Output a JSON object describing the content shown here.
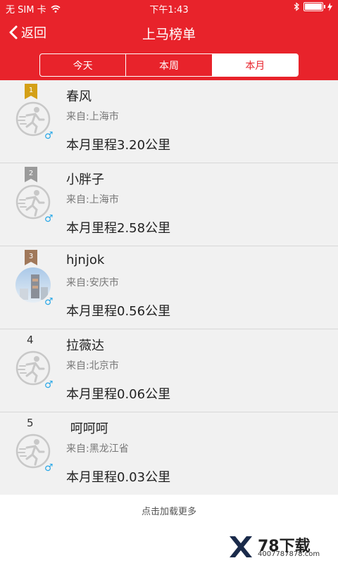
{
  "status": {
    "carrier": "无 SIM 卡",
    "time": "下午1:43"
  },
  "nav": {
    "back_label": "返回",
    "title": "上马榜单"
  },
  "tabs": [
    {
      "label": "今天",
      "active": false
    },
    {
      "label": "本周",
      "active": false
    },
    {
      "label": "本月",
      "active": true
    }
  ],
  "rankings": [
    {
      "rank": "1",
      "badge_color": "#d4a017",
      "name": "春风",
      "from": "来自:上海市",
      "mileage": "本月里程3.20公里",
      "gender": "♂",
      "avatar": "runner-icon"
    },
    {
      "rank": "2",
      "badge_color": "#9a9a9a",
      "name": "小胖子",
      "from": "来自:上海市",
      "mileage": "本月里程2.58公里",
      "gender": "♂",
      "avatar": "runner-icon"
    },
    {
      "rank": "3",
      "badge_color": "#a0785a",
      "name": "hjnjok",
      "from": "来自:安庆市",
      "mileage": "本月里程0.56公里",
      "gender": "♂",
      "avatar": "photo"
    },
    {
      "rank": "4",
      "name": "拉薇达",
      "from": "来自:北京市",
      "mileage": "本月里程0.06公里",
      "gender": "♂",
      "avatar": "runner-icon"
    },
    {
      "rank": "5",
      "name": " 呵呵呵",
      "from": "来自:黑龙江省",
      "mileage": "本月里程0.03公里",
      "gender": "♂",
      "avatar": "runner-icon"
    }
  ],
  "load_more": "点击加载更多",
  "watermark": {
    "logo": "78下载",
    "url": "4007787878.com"
  }
}
